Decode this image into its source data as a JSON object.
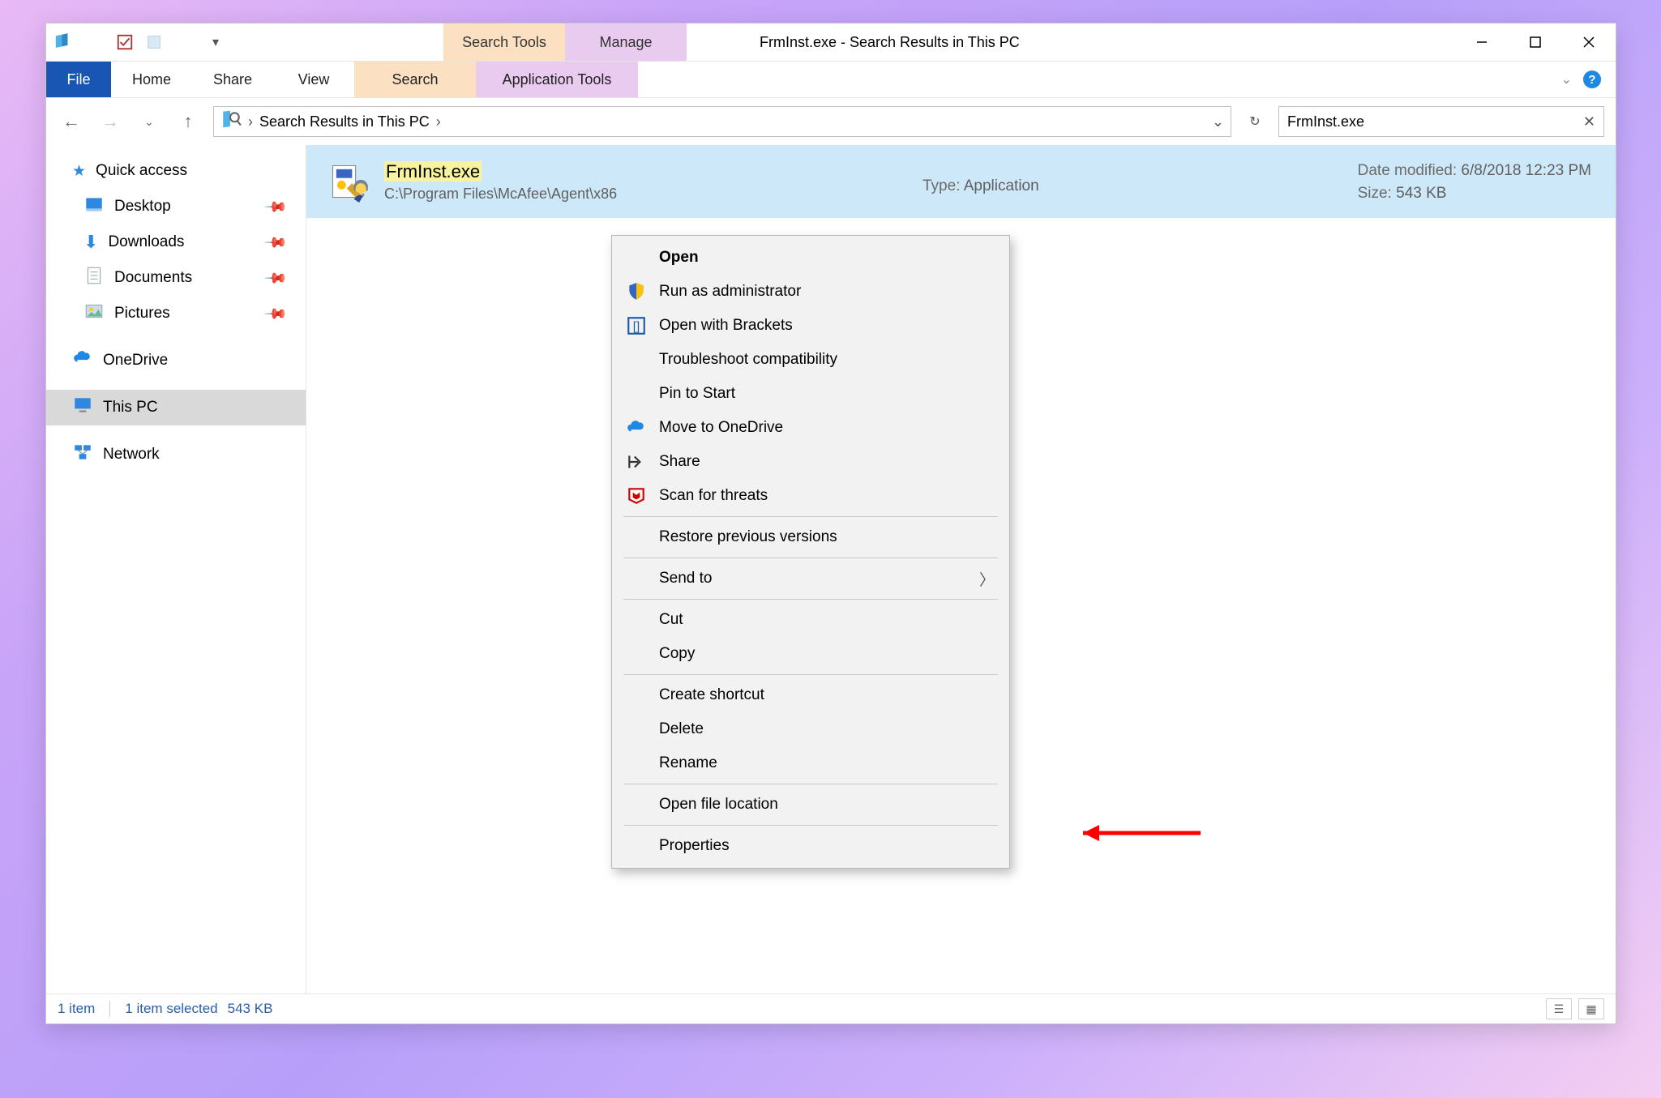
{
  "window": {
    "title": "FrmInst.exe - Search Results in This PC",
    "ctx_tabs": {
      "search": "Search Tools",
      "manage": "Manage"
    }
  },
  "ribbon": {
    "file": "File",
    "home": "Home",
    "share": "Share",
    "view": "View",
    "search": "Search",
    "app_tools": "Application Tools"
  },
  "address": {
    "segment": "Search Results in This PC"
  },
  "search": {
    "value": "FrmInst.exe"
  },
  "sidebar": {
    "quick_access": "Quick access",
    "desktop": "Desktop",
    "downloads": "Downloads",
    "documents": "Documents",
    "pictures": "Pictures",
    "onedrive": "OneDrive",
    "this_pc": "This PC",
    "network": "Network"
  },
  "result": {
    "name": "FrmInst.exe",
    "path": "C:\\Program Files\\McAfee\\Agent\\x86",
    "type_label": "Type:",
    "type_value": "Application",
    "date_label": "Date modified:",
    "date_value": "6/8/2018 12:23 PM",
    "size_label": "Size:",
    "size_value": "543 KB"
  },
  "context_menu": {
    "open": "Open",
    "run_admin": "Run as administrator",
    "open_brackets": "Open with Brackets",
    "troubleshoot": "Troubleshoot compatibility",
    "pin_start": "Pin to Start",
    "move_onedrive": "Move to OneDrive",
    "share": "Share",
    "scan_threats": "Scan for threats",
    "restore_prev": "Restore previous versions",
    "send_to": "Send to",
    "cut": "Cut",
    "copy": "Copy",
    "create_shortcut": "Create shortcut",
    "delete": "Delete",
    "rename": "Rename",
    "open_location": "Open file location",
    "properties": "Properties"
  },
  "status": {
    "count": "1 item",
    "selected": "1 item selected",
    "sel_size": "543 KB"
  }
}
